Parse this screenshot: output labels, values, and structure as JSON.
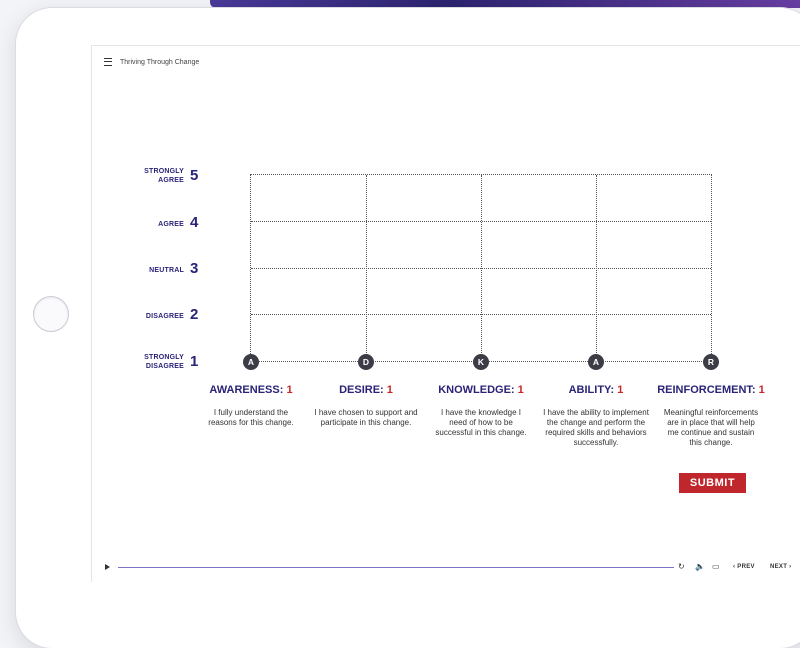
{
  "header": {
    "title": "Thriving Through Change"
  },
  "scale": [
    {
      "word": "STRONGLY AGREE",
      "line1": "STRONGLY",
      "line2": "AGREE",
      "num": "5"
    },
    {
      "word": "AGREE",
      "num": "4"
    },
    {
      "word": "NEUTRAL",
      "num": "3"
    },
    {
      "word": "DISAGREE",
      "num": "2"
    },
    {
      "word": "STRONGLY DISAGREE",
      "line1": "STRONGLY",
      "line2": "DISAGREE",
      "num": "1"
    }
  ],
  "columns": [
    {
      "marker": "A",
      "title": "AWARENESS:",
      "value": "1",
      "desc": "I fully understand the reasons for this change."
    },
    {
      "marker": "D",
      "title": "DESIRE:",
      "value": "1",
      "desc": "I have chosen to support and participate in this change."
    },
    {
      "marker": "K",
      "title": "KNOWLEDGE:",
      "value": "1",
      "desc": "I have the knowledge I need of how to be successful in this change."
    },
    {
      "marker": "A",
      "title": "ABILITY:",
      "value": "1",
      "desc": "I have the ability to implement the change and perform the required skills and behaviors successfully."
    },
    {
      "marker": "R",
      "title": "REINFORCEMENT:",
      "value": "1",
      "desc": "Meaningful reinforcements are in place that will help me continue and sustain this change."
    }
  ],
  "submit_label": "SUBMIT",
  "player": {
    "prev": "PREV",
    "next": "NEXT",
    "replay": "↻",
    "volume": "🔈",
    "captions": "▭"
  },
  "colors": {
    "accent": "#2a2377",
    "value_red": "#c62828",
    "submit": "#c0272d",
    "progress": "#7a72c6"
  }
}
